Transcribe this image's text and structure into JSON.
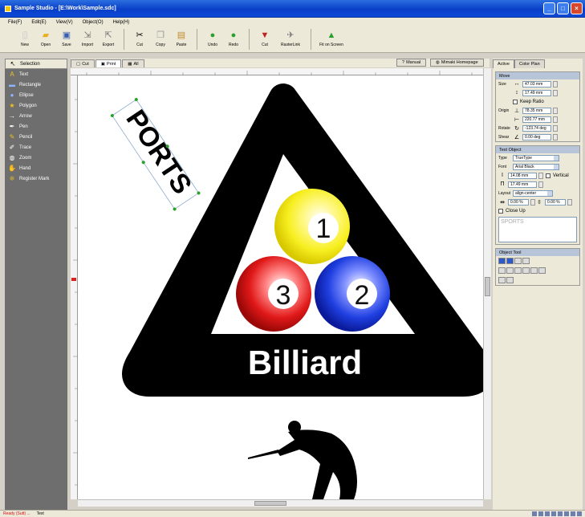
{
  "app": {
    "title": "Sample Studio - [E:\\Work\\Sample.sdc]",
    "colors": {
      "title_bar": "#0a3fc8",
      "left_panel": "#6e6e6e",
      "triangle": "#000000",
      "ball1": "#f7ef20",
      "ball2": "#1f3fe0",
      "ball3": "#e01818",
      "group_header": "#b8c4d8"
    }
  },
  "window_buttons": [
    {
      "name": "minimize",
      "label": "_"
    },
    {
      "name": "maximize",
      "label": "□"
    },
    {
      "name": "close",
      "label": "×"
    }
  ],
  "menu": [
    "File(F)",
    "Edit(E)",
    "View(V)",
    "Object(O)",
    "Help(H)"
  ],
  "toolbar": {
    "file_group": [
      {
        "label": "New",
        "icon": "new-icon"
      },
      {
        "label": "Open",
        "icon": "open-icon"
      },
      {
        "label": "Save",
        "icon": "save-icon"
      },
      {
        "label": "Import",
        "icon": "import-icon"
      },
      {
        "label": "Export",
        "icon": "export-icon"
      }
    ],
    "edit_group": [
      {
        "label": "Cut",
        "icon": "cut-icon"
      },
      {
        "label": "Copy",
        "icon": "copy-icon"
      },
      {
        "label": "Paste",
        "icon": "paste-icon"
      }
    ],
    "history_group": [
      {
        "label": "Undo",
        "icon": "undo-icon"
      },
      {
        "label": "Redo",
        "icon": "redo-icon"
      }
    ],
    "cut_group": [
      {
        "label": "Cut",
        "icon": "cutter-icon"
      },
      {
        "label": "RasterLink",
        "icon": "rasterlink-icon"
      }
    ],
    "fit_button": {
      "label": "Fit on Screen",
      "icon": "fit-icon"
    }
  },
  "tools": [
    {
      "label": "Selection",
      "icon": "selection-icon",
      "active": true
    },
    {
      "label": "Text",
      "icon": "text-icon"
    },
    {
      "label": "Rectangle",
      "icon": "rectangle-icon"
    },
    {
      "label": "Ellipse",
      "icon": "ellipse-icon"
    },
    {
      "label": "Polygon",
      "icon": "polygon-icon"
    },
    {
      "label": "Arrow",
      "icon": "arrow-icon"
    },
    {
      "label": "Pen",
      "icon": "pen-icon"
    },
    {
      "label": "Pencil",
      "icon": "pencil-icon"
    },
    {
      "label": "Trace",
      "icon": "trace-icon"
    },
    {
      "label": "Zoom",
      "icon": "zoom-icon"
    },
    {
      "label": "Hand",
      "icon": "hand-icon"
    },
    {
      "label": "Register Mark",
      "icon": "register-mark-icon"
    }
  ],
  "canvas_tabs": [
    {
      "label": "Cut",
      "active": false
    },
    {
      "label": "Print",
      "active": true
    },
    {
      "label": "All",
      "active": false
    }
  ],
  "canvas_right_tabs": [
    {
      "label": "Manual"
    },
    {
      "label": "Mimaki Homepage"
    }
  ],
  "canvas": {
    "rotated_text": "PORTS",
    "ball1": "1",
    "ball2": "2",
    "ball3": "3",
    "billiard_text": "Billiard"
  },
  "right_panel": {
    "tabs": [
      "Active",
      "Color Plan"
    ],
    "move": {
      "header": "Move",
      "size_label": "Size",
      "width": "47.03 mm",
      "height": "17.49 mm",
      "keep_ratio": "Keep Ratio",
      "origin_label": "Origin",
      "origin_x": "78.35 mm",
      "origin_y": "220.77 mm",
      "rotate_label": "Rotate",
      "rotate": "-123.74 deg",
      "shear_label": "Shear",
      "shear": "0.00 deg"
    },
    "text_object": {
      "header": "Text Object",
      "type_label": "Type",
      "type": "TrueType",
      "font_label": "Font",
      "font": "Arial Black",
      "size1": "14.08 mm",
      "vertical": "Vertical",
      "size2": "17.49 mm",
      "layout_label": "Layout",
      "layout": "align-center",
      "spacing1": "0.00 %",
      "spacing2": "0.00 %",
      "close_up": "Close Up",
      "text_content": "SPORTS"
    },
    "object_tool": {
      "header": "Object Tool"
    }
  },
  "status": [
    "Ready (Sutt) ...",
    "Text"
  ]
}
